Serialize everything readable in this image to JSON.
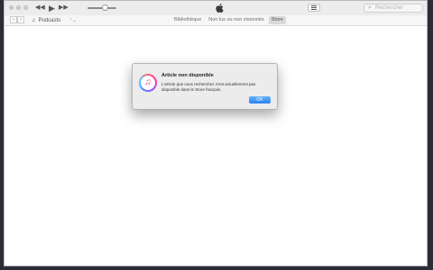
{
  "toolbar": {
    "back_glyph": "◀◀",
    "play_glyph": "▶",
    "forward_glyph": "▶▶",
    "search_placeholder": "Rechercher",
    "search_glyph": "⌕"
  },
  "navbar": {
    "back_glyph": "‹",
    "forward_glyph": "›",
    "media_icon": "♫",
    "media_label": "Podcasts",
    "media_chevron": "⌃⌄",
    "tabs": [
      {
        "label": "Bibliothèque"
      },
      {
        "label": "Non lus ou non visionnés"
      },
      {
        "label": "Store"
      }
    ],
    "active_tab": "Store"
  },
  "dialog": {
    "icon_glyph": "♫",
    "title": "Article non disponible",
    "message": "L'article que vous recherchez n'est actuellement pas disponible dans le Store français.",
    "ok_label": "OK"
  },
  "colors": {
    "accent": "#2a7ff0",
    "background": "#2a2d35"
  }
}
